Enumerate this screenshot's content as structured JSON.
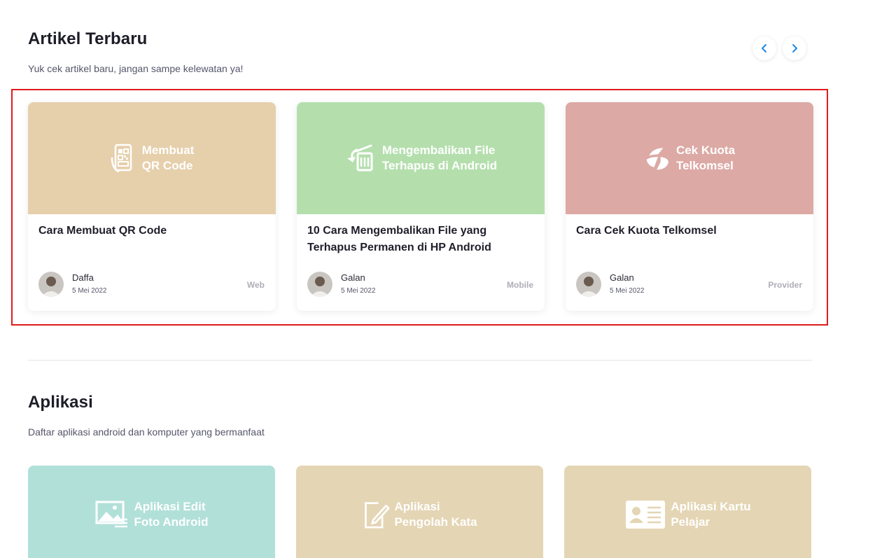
{
  "articles_section": {
    "title": "Artikel Terbaru",
    "subtitle": "Yuk cek artikel baru, jangan sampe kelewatan ya!",
    "prev_icon": "chevron-left-icon",
    "next_icon": "chevron-right-icon",
    "accent_color": "#1e88e5",
    "cards": [
      {
        "banner_text": "Membuat\nQR Code",
        "banner_color": "#e6cfab",
        "banner_icon": "qr-phone-icon",
        "title": "Cara Membuat QR Code",
        "author": "Daffa",
        "date": "5 Mei 2022",
        "category": "Web"
      },
      {
        "banner_text": "Mengembalikan File\nTerhapus di Android",
        "banner_color": "#b4dfad",
        "banner_icon": "restore-trash-icon",
        "title": "10 Cara Mengembalikan File yang Terhapus Permanen di HP Android",
        "author": "Galan",
        "date": "5 Mei 2022",
        "category": "Mobile"
      },
      {
        "banner_text": "Cek Kuota\nTelkomsel",
        "banner_color": "#dca9a5",
        "banner_icon": "telkomsel-logo-icon",
        "title": "Cara Cek Kuota Telkomsel",
        "author": "Galan",
        "date": "5 Mei 2022",
        "category": "Provider"
      }
    ]
  },
  "apps_section": {
    "title": "Aplikasi",
    "subtitle": "Daftar aplikasi android dan komputer yang bermanfaat",
    "cards": [
      {
        "banner_text": "Aplikasi Edit\nFoto Android",
        "banner_color": "#b1e0d9",
        "banner_icon": "photo-edit-icon"
      },
      {
        "banner_text": "Aplikasi\nPengolah Kata",
        "banner_color": "#e4d5b4",
        "banner_icon": "document-edit-icon"
      },
      {
        "banner_text": "Aplikasi Kartu\nPelajar",
        "banner_color": "#e4d5b4",
        "banner_icon": "id-card-icon"
      }
    ]
  }
}
